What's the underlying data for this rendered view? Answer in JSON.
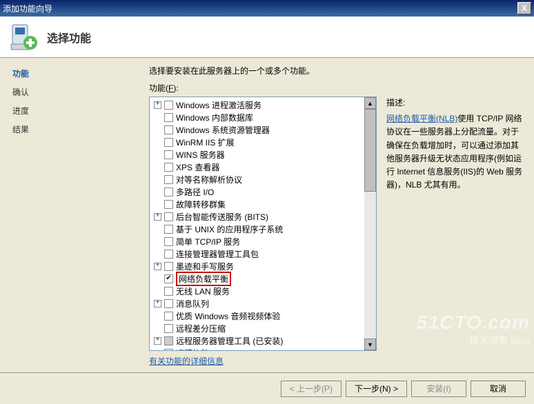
{
  "window": {
    "title": "添加功能向导",
    "close": "X"
  },
  "header": {
    "title": "选择功能"
  },
  "sidebar": {
    "steps": [
      "功能",
      "确认",
      "进度",
      "结果"
    ],
    "active": 0
  },
  "main": {
    "instruction": "选择要安装在此服务器上的一个或多个功能。",
    "features_label_prefix": "功能(",
    "features_label_key": "F",
    "features_label_suffix": "):",
    "more_info": "有关功能的详细信息"
  },
  "tree": [
    {
      "expand": "+",
      "check": "",
      "label": "Windows 进程激活服务"
    },
    {
      "expand": "",
      "check": "",
      "label": "Windows 内部数据库"
    },
    {
      "expand": "",
      "check": "",
      "label": "Windows 系统资源管理器"
    },
    {
      "expand": "",
      "check": "",
      "label": "WinRM IIS 扩展"
    },
    {
      "expand": "",
      "check": "",
      "label": "WINS 服务器"
    },
    {
      "expand": "",
      "check": "",
      "label": "XPS 查看器"
    },
    {
      "expand": "",
      "check": "",
      "label": "对等名称解析协议"
    },
    {
      "expand": "",
      "check": "",
      "label": "多路径 I/O"
    },
    {
      "expand": "",
      "check": "",
      "label": "故障转移群集"
    },
    {
      "expand": "+",
      "check": "",
      "label": "后台智能传送服务 (BITS)"
    },
    {
      "expand": "",
      "check": "",
      "label": "基于 UNIX 的应用程序子系统"
    },
    {
      "expand": "",
      "check": "",
      "label": "简单 TCP/IP 服务"
    },
    {
      "expand": "",
      "check": "",
      "label": "连接管理器管理工具包"
    },
    {
      "expand": "+",
      "check": "",
      "label": "墨迹和手写服务"
    },
    {
      "expand": "",
      "check": "checked",
      "label": "网络负载平衡",
      "selected": true
    },
    {
      "expand": "",
      "check": "",
      "label": "无线 LAN 服务"
    },
    {
      "expand": "+",
      "check": "",
      "label": "消息队列"
    },
    {
      "expand": "",
      "check": "",
      "label": "优质 Windows 音频视频体验"
    },
    {
      "expand": "",
      "check": "",
      "label": "远程差分压缩"
    },
    {
      "expand": "+",
      "check": "gray",
      "label": "远程服务器管理工具   (已安装)"
    },
    {
      "expand": "",
      "check": "",
      "label": "远程协助"
    }
  ],
  "description": {
    "title": "描述:",
    "link": "网络负载平衡(NLB)",
    "text": "使用 TCP/IP 网络协议在一些服务器上分配流量。对于确保在负载增加时，可以通过添加其他服务器升级无状态应用程序(例如运行 Internet 信息服务(IIS)的 Web 服务器)，NLB 尤其有用。"
  },
  "footer": {
    "prev": "< 上一步(P)",
    "next": "下一步(N) >",
    "install": "安装(I)",
    "cancel": "取消"
  },
  "watermark": {
    "big": "51CTO.com",
    "small": "技术博客    Blog"
  }
}
